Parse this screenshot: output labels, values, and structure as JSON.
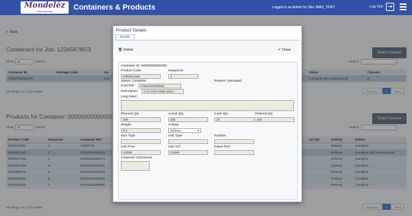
{
  "header": {
    "logo_text": "Mondelēz",
    "logo_sub": "International",
    "title": "Containers & Products",
    "login_info": "Logged in as Admin for Site: MAN_TRIPT",
    "logout": "Log Out"
  },
  "back": "Back",
  "containers": {
    "title": "Containers for Job: 12345678G3",
    "select_columns": "Select Columns",
    "show": "Show",
    "show_value": "all",
    "entries": "entries",
    "search": "Search:",
    "columns": [
      "Container ID",
      "Package Code",
      "De",
      "Status",
      "Claused"
    ],
    "rows": [
      {
        "container_id": "00000000000000",
        "package_code": "",
        "de": "Loc",
        "status": "Complete with Amendments",
        "claused": "N"
      }
    ],
    "info": "Showing 1 to 1 of 1 entries",
    "pager": {
      "previous": "Previous",
      "page": "1",
      "next": "Next"
    }
  },
  "products": {
    "title": "Products for Container: 00000000000000",
    "select_columns": "Select Columns",
    "show": "Show",
    "show_value": "all",
    "entries": "entries",
    "search": "Search:",
    "columns": [
      "Product Code",
      "Sequence",
      "Customer Ref.",
      "ual Qty",
      "Activity",
      "Status"
    ],
    "rows": [
      {
        "code": "0000612592",
        "seq": "1",
        "ref": "11002772",
        "activity": "Delivery",
        "status": "Complete"
      },
      {
        "code": "0000631263",
        "seq": "2",
        "ref": "07622210039200",
        "activity": "Delivery",
        "status": "Complete with Amendments"
      },
      {
        "code": "0000677126",
        "seq": "3",
        "ref": "07622210109272",
        "activity": "Delivery",
        "status": "Complete"
      },
      {
        "code": "0000964160",
        "seq": "4",
        "ref": "07622300700001",
        "activity": "Delivery",
        "status": "Complete"
      },
      {
        "code": "0004060576",
        "seq": "5",
        "ref": "07622210788148",
        "activity": "Delivery",
        "status": "Complete"
      },
      {
        "code": "0004245254",
        "seq": "6",
        "ref": "07622210285132",
        "activity": "Delivery",
        "status": "Complete"
      },
      {
        "code": "0004245284",
        "seq": "7",
        "ref": "07622210286901",
        "activity": "Delivery",
        "status": "Complete"
      }
    ],
    "info": "Showing 1 to 7 of 7 entries",
    "pager": {
      "previous": "Previous",
      "page": "1",
      "next": "Next"
    }
  },
  "dialog": {
    "title": "Product Details",
    "tab": "Details",
    "delete": "Delete",
    "close": "Close",
    "container_id": "Container ID: 00000000000000",
    "product_code_label": "Product Code:",
    "product_code": "0000631263",
    "sequence_label": "Sequence:",
    "sequence": "2",
    "status": "Status: Complete",
    "reason": "Reason: Damaged",
    "cust_ref_label": "Cust Ref.:",
    "cust_ref": "07622210039200",
    "description_label": "Description:",
    "description": "CAO STD FRED 60CA",
    "long_desc_label": "Long Desc:",
    "planned_qty_label": "Planned Qty",
    "planned_qty": "340",
    "actual_qty_label": "Actual Qty",
    "actual_qty": "330",
    "case_qty_label": "Case Qty",
    "case_qty": "10",
    "ordered_qty_label": "Ordered Qty",
    "ordered_qty": "340",
    "weight_label": "Weight",
    "weight": "0.2",
    "activity_label": "Activity",
    "activity": "Delivery",
    "item_type_label": "Item Type",
    "unit_type_label": "Unit Type:",
    "position_label": "Position",
    "unit_price_label": "Unit Price",
    "unit_price": "0.0000",
    "unit_vat_label": "Unit VAT",
    "unit_vat": "0.0000",
    "depot_text_label": "Depot Text",
    "customer_comments_label": "Customer Comments"
  }
}
